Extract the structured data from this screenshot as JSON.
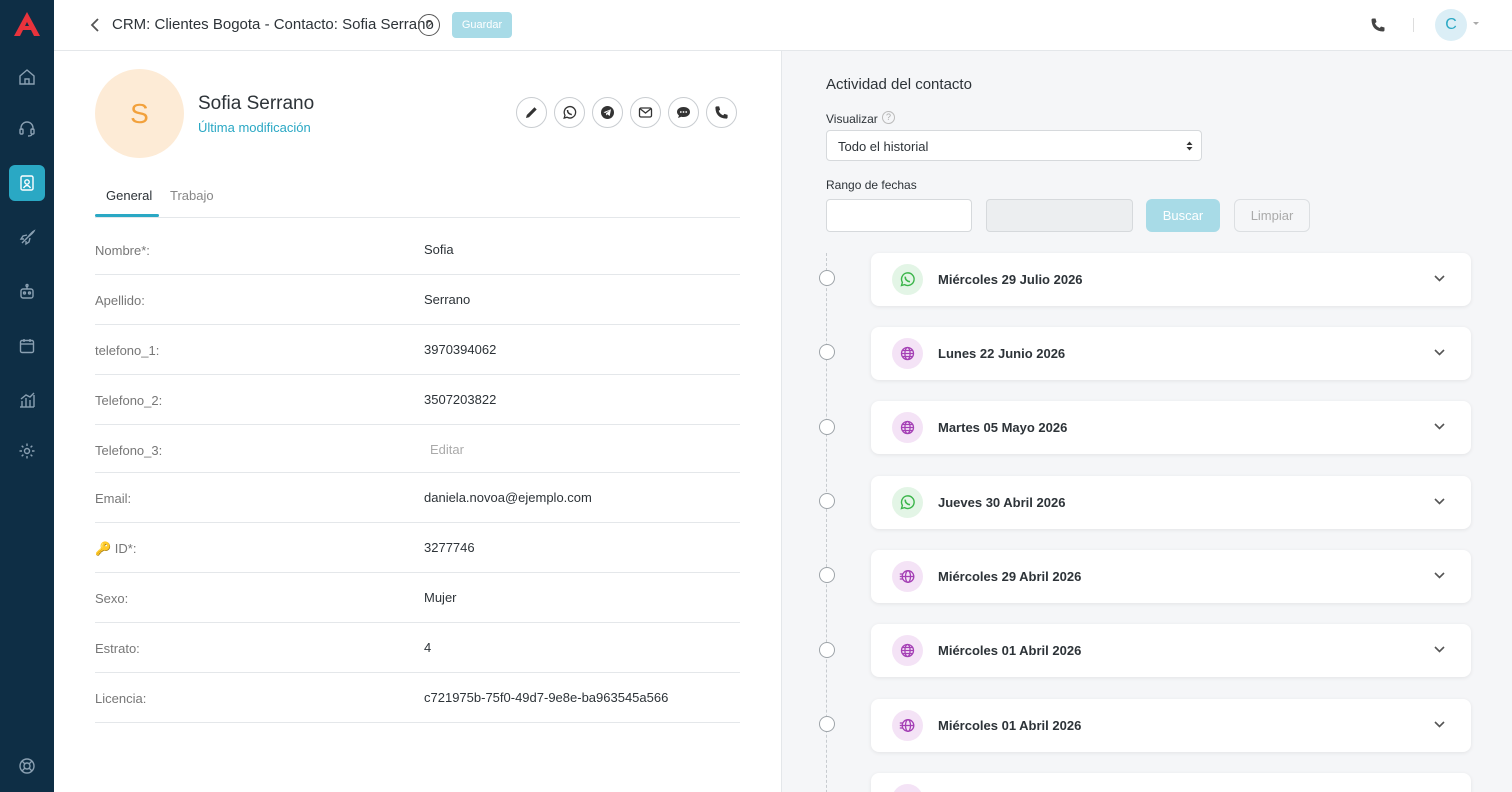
{
  "header": {
    "title": "CRM: Clientes Bogota - Contacto: Sofia Serrano",
    "help_label": "?",
    "save_label": "Guardar",
    "user_initial": "C"
  },
  "contact": {
    "initial": "S",
    "name": "Sofia Serrano",
    "last_modified_label": "Última modificación"
  },
  "actions": [
    "edit-icon",
    "whatsapp-icon",
    "telegram-icon",
    "email-icon",
    "chat-icon",
    "phone-icon"
  ],
  "tabs": [
    {
      "label": "General",
      "active": true
    },
    {
      "label": "Trabajo",
      "active": false
    }
  ],
  "fields": [
    {
      "label": "Nombre*:",
      "value": "Sofia"
    },
    {
      "label": "Apellido:",
      "value": "Serrano"
    },
    {
      "label": "telefono_1:",
      "value": "3970394062"
    },
    {
      "label": "Telefono_2:",
      "value": "3507203822"
    },
    {
      "label": "Telefono_3:",
      "value": "Editar"
    },
    {
      "label": "Email:",
      "value": "daniela.novoa@ejemplo.com"
    },
    {
      "label": "🔑 ID*:",
      "value": "3277746"
    },
    {
      "label": "Sexo:",
      "value": "Mujer"
    },
    {
      "label": "Estrato:",
      "value": "4"
    },
    {
      "label": "Licencia:",
      "value": "c721975b-75f0-49d7-9e8e-ba963545a566"
    }
  ],
  "activity": {
    "title": "Actividad del contacto",
    "visualize_label": "Visualizar",
    "visualize_help": "?",
    "visualize_value": "Todo el historial",
    "range_label": "Rango de fechas",
    "search_label": "Buscar",
    "clear_label": "Limpiar",
    "items": [
      {
        "date": "Miércoles 29 Julio 2026",
        "channel": "whatsapp-icon"
      },
      {
        "date": "Lunes 22 Junio 2026",
        "channel": "web-icon"
      },
      {
        "date": "Martes 05 Mayo 2026",
        "channel": "web-icon"
      },
      {
        "date": "Jueves 30 Abril 2026",
        "channel": "whatsapp-icon"
      },
      {
        "date": "Miércoles 29 Abril 2026",
        "channel": "web-fast-icon"
      },
      {
        "date": "Miércoles 01 Abril 2026",
        "channel": "web-icon"
      },
      {
        "date": "Miércoles 01 Abril 2026",
        "channel": "web-fast-icon"
      }
    ]
  },
  "colors": {
    "sidebar": "#0e2e45",
    "accent": "#2aa8c4",
    "brand_logo": "#e8333c",
    "whatsapp": "#3bb54a",
    "web": "#a43fb5"
  }
}
